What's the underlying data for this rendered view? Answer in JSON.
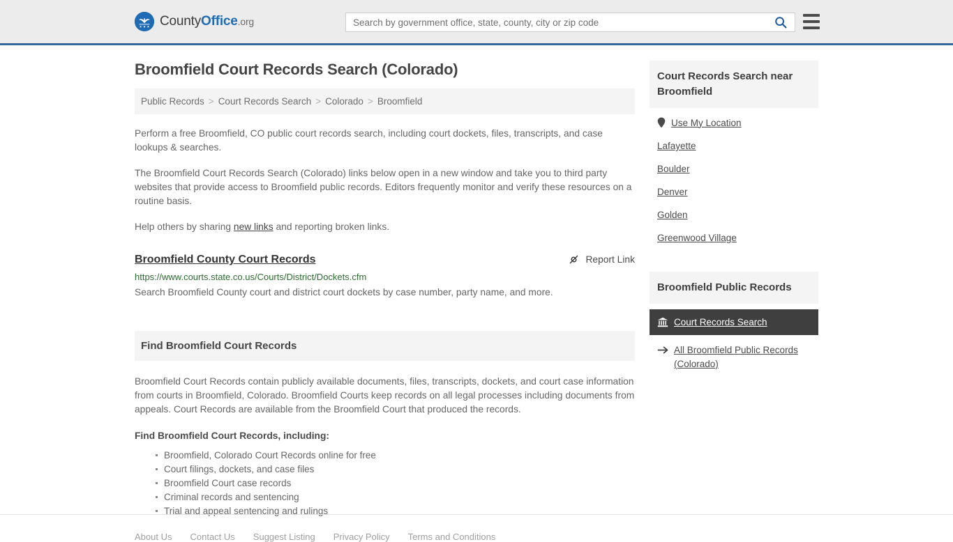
{
  "header": {
    "logo": {
      "icon": "eagle-shield-icon",
      "text_county": "County",
      "text_office": "Office",
      "text_org": ".org"
    },
    "search": {
      "placeholder": "Search by government office, state, county, city or zip code",
      "value": "",
      "search_icon": "search-icon"
    },
    "menu_icon": "hamburger-menu-icon"
  },
  "page": {
    "title": "Broomfield Court Records Search (Colorado)"
  },
  "breadcrumb": {
    "separator": ">",
    "items": [
      {
        "label": "Public Records",
        "current": false
      },
      {
        "label": "Court Records Search",
        "current": false
      },
      {
        "label": "Colorado",
        "current": false
      },
      {
        "label": "Broomfield",
        "current": true
      }
    ]
  },
  "intro": {
    "p1": "Perform a free Broomfield, CO public court records search, including court dockets, files, transcripts, and case lookups & searches.",
    "p2": "The Broomfield Court Records Search (Colorado) links below open in a new window and take you to third party websites that provide access to Broomfield public records. Editors frequently monitor and verify these resources on a routine basis.",
    "p3_before": "Help others by sharing ",
    "p3_link": "new links",
    "p3_after": " and reporting broken links."
  },
  "result": {
    "title": "Broomfield County Court Records",
    "report_label": "Report Link",
    "report_icon": "broken-link-icon",
    "url": "https://www.courts.state.co.us/Courts/District/Dockets.cfm",
    "description": "Search Broomfield County court and district court dockets by case number, party name, and more."
  },
  "find_section": {
    "heading": "Find Broomfield Court Records",
    "body": "Broomfield Court Records contain publicly available documents, files, transcripts, dockets, and court case information from courts in Broomfield, Colorado. Broomfield Courts keep records on all legal processes including documents from appeals. Court Records are available from the Broomfield Court that produced the records.",
    "list_heading": "Find Broomfield Court Records, including:",
    "bullets": [
      "Broomfield, Colorado Court Records online for free",
      "Court filings, dockets, and case files",
      "Broomfield Court case records",
      "Criminal records and sentencing",
      "Trial and appeal sentencing and rulings"
    ]
  },
  "sidebar": {
    "nearby": {
      "heading": "Court Records Search near Broomfield",
      "use_my_location": {
        "label": "Use My Location",
        "icon": "map-pin-icon"
      },
      "cities": [
        "Lafayette",
        "Boulder",
        "Denver",
        "Golden",
        "Greenwood Village"
      ]
    },
    "public_records": {
      "heading": "Broomfield Public Records",
      "active_item": {
        "label": "Court Records Search",
        "icon": "courthouse-icon"
      },
      "all_records": {
        "label": "All Broomfield Public Records (Colorado)",
        "icon": "arrow-right-icon"
      }
    }
  },
  "footer": {
    "links": [
      "About Us",
      "Contact Us",
      "Suggest Listing",
      "Privacy Policy",
      "Terms and Conditions"
    ]
  },
  "colors": {
    "brand_blue": "#1f6cb4",
    "header_bg": "#ececec",
    "header_border": "#33689c",
    "panel_bg": "#f4f4f4",
    "dark_item": "#3f3f3f",
    "url_green": "#2c6b2f",
    "body_text": "#666666"
  }
}
